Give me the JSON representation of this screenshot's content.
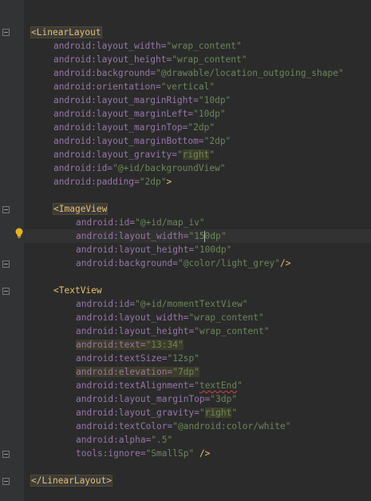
{
  "colors": {
    "background": "#2b2b2b",
    "gutter": "#313335",
    "namespace": "#9876aa",
    "string": "#6a8759",
    "tag": "#e8bf6a",
    "punctuation": "#a9b7c6"
  },
  "lines": {
    "l1": {
      "open": "<",
      "tag": "LinearLayout"
    },
    "l2": {
      "ns": "android",
      "attr": ":layout_width=",
      "val": "\"wrap_content\""
    },
    "l3": {
      "ns": "android",
      "attr": ":layout_height=",
      "val": "\"wrap_content\""
    },
    "l4": {
      "ns": "android",
      "attr": ":background=",
      "val": "\"@drawable/location_outgoing_shape\""
    },
    "l5": {
      "ns": "android",
      "attr": ":orientation=",
      "val": "\"vertical\""
    },
    "l6": {
      "ns": "android",
      "attr": ":layout_marginRight=",
      "val": "\"10dp\""
    },
    "l7": {
      "ns": "android",
      "attr": ":layout_marginLeft=",
      "val": "\"10dp\""
    },
    "l8": {
      "ns": "android",
      "attr": ":layout_marginTop=",
      "val": "\"2dp\""
    },
    "l9": {
      "ns": "android",
      "attr": ":layout_marginBottom=",
      "val": "\"2dp\""
    },
    "l10": {
      "ns": "android",
      "attr": ":layout_gravity=",
      "q1": "\"",
      "hl": "right",
      "q2": "\""
    },
    "l11": {
      "ns": "android",
      "attr": ":id=",
      "val": "\"@+id/backgroundView\""
    },
    "l12": {
      "ns": "android",
      "attr": ":padding=",
      "val": "\"2dp\"",
      "close": ">"
    },
    "l14": {
      "open": "<",
      "tag": "ImageView"
    },
    "l15": {
      "ns": "android",
      "attr": ":id=",
      "val": "\"@+id/map_iv\""
    },
    "l16": {
      "ns": "android",
      "attr": ":layout_width=",
      "v1": "\"15",
      "v2": "0dp\""
    },
    "l17": {
      "ns": "android",
      "attr": ":layout_height=",
      "val": "\"100dp\""
    },
    "l18": {
      "ns": "android",
      "attr": ":background=",
      "val": "\"@color/light_grey\"",
      "close": "/>"
    },
    "l20": {
      "open": "<",
      "tag": "TextView"
    },
    "l21": {
      "ns": "android",
      "attr": ":id=",
      "val": "\"@+id/momentTextView\""
    },
    "l22": {
      "ns": "android",
      "attr": ":layout_width=",
      "val": "\"wrap_content\""
    },
    "l23": {
      "ns": "android",
      "attr": ":layout_height=",
      "val": "\"wrap_content\""
    },
    "l24": {
      "ns": "android",
      "attr": ":text=",
      "val": "\"13:34\""
    },
    "l25": {
      "ns": "android",
      "attr": ":textSize=",
      "val": "\"12sp\""
    },
    "l26": {
      "ns": "android",
      "attr": ":elevation=",
      "val": "\"7dp\""
    },
    "l27": {
      "ns": "android",
      "attr": ":textAlignment=",
      "q1": "\"",
      "sq": "textEnd",
      "q2": "\""
    },
    "l28": {
      "ns": "android",
      "attr": ":layout_marginTop=",
      "val": "\"3dp\""
    },
    "l29": {
      "ns": "android",
      "attr": ":layout_gravity=",
      "q1": "\"",
      "hl": "right",
      "q2": "\""
    },
    "l30": {
      "ns": "android",
      "attr": ":textColor=",
      "val": "\"@android:color/white\""
    },
    "l31": {
      "ns": "android",
      "attr": ":alpha=",
      "val": "\".5\""
    },
    "l32": {
      "ns": "tools",
      "attr": ":ignore=",
      "val": "\"SmallSp\"",
      "close": " />"
    },
    "l34": {
      "open": "</",
      "tag": "LinearLayout",
      "close": ">"
    }
  }
}
